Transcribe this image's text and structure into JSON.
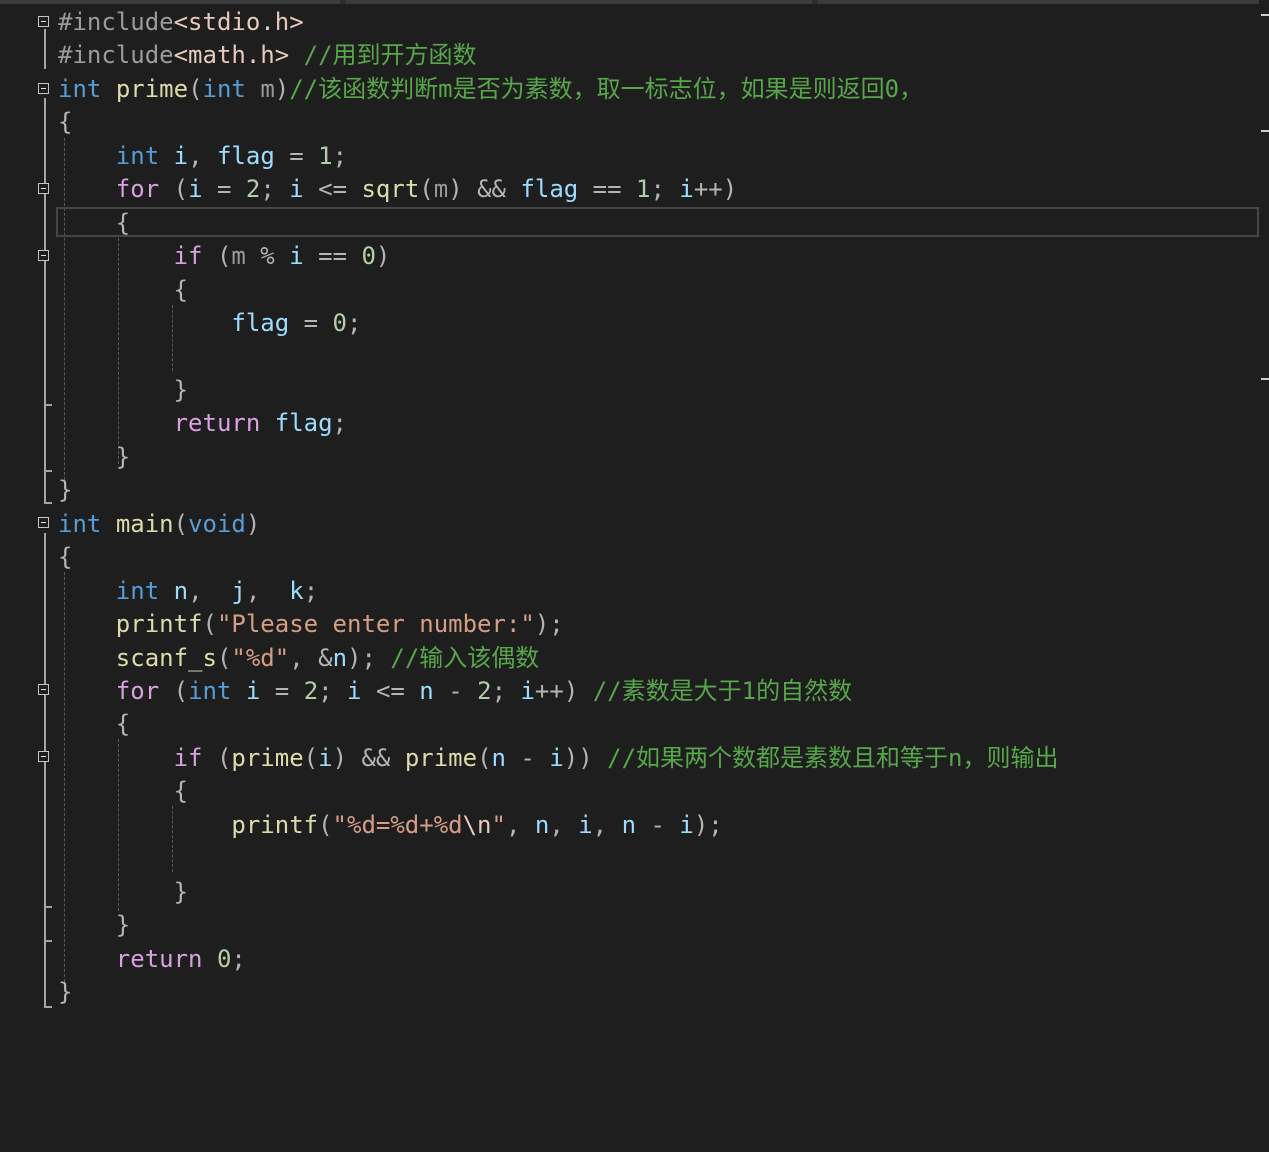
{
  "editor": {
    "colors": {
      "background": "#1e1e1e",
      "keyword": "#569cd6",
      "control": "#d8a0df",
      "function": "#dcdcaa",
      "variable": "#9cdcfe",
      "number": "#b5cea8",
      "string": "#d69d85",
      "comment": "#57a64a",
      "preprocessor": "#9b9b9b"
    },
    "lines": [
      [
        [
          "pp",
          "#include"
        ],
        [
          "inc",
          "<stdio.h>"
        ]
      ],
      [
        [
          "pp",
          "#include"
        ],
        [
          "inc",
          "<math.h>"
        ],
        [
          "pn",
          " "
        ],
        [
          "cm",
          "//用到开方函数"
        ]
      ],
      [
        [
          "kw",
          "int"
        ],
        [
          "pn",
          " "
        ],
        [
          "fn",
          "prime"
        ],
        [
          "pn",
          "("
        ],
        [
          "kw",
          "int"
        ],
        [
          "pn",
          " "
        ],
        [
          "param",
          "m"
        ],
        [
          "pn",
          ")"
        ],
        [
          "cm",
          "//该函数判断m是否为素数，取一标志位，如果是则返回0，"
        ]
      ],
      [
        [
          "pn",
          "{"
        ]
      ],
      [
        [
          "pn",
          "    "
        ],
        [
          "kw",
          "int"
        ],
        [
          "pn",
          " "
        ],
        [
          "var",
          "i"
        ],
        [
          "pn",
          ", "
        ],
        [
          "var",
          "flag"
        ],
        [
          "op",
          " = "
        ],
        [
          "num",
          "1"
        ],
        [
          "pn",
          ";"
        ]
      ],
      [
        [
          "pn",
          "    "
        ],
        [
          "ctl",
          "for"
        ],
        [
          "pn",
          " ("
        ],
        [
          "var",
          "i"
        ],
        [
          "op",
          " = "
        ],
        [
          "num",
          "2"
        ],
        [
          "pn",
          "; "
        ],
        [
          "var",
          "i"
        ],
        [
          "op",
          " <= "
        ],
        [
          "fn",
          "sqrt"
        ],
        [
          "pn",
          "("
        ],
        [
          "param",
          "m"
        ],
        [
          "pn",
          ")"
        ],
        [
          "op",
          " && "
        ],
        [
          "var",
          "flag"
        ],
        [
          "op",
          " == "
        ],
        [
          "num",
          "1"
        ],
        [
          "pn",
          "; "
        ],
        [
          "var",
          "i"
        ],
        [
          "op",
          "++"
        ],
        [
          "pn",
          ")"
        ]
      ],
      [
        [
          "pn",
          "    {"
        ]
      ],
      [
        [
          "pn",
          "        "
        ],
        [
          "ctl",
          "if"
        ],
        [
          "pn",
          " ("
        ],
        [
          "param",
          "m"
        ],
        [
          "op",
          " % "
        ],
        [
          "var",
          "i"
        ],
        [
          "op",
          " == "
        ],
        [
          "num",
          "0"
        ],
        [
          "pn",
          ")"
        ]
      ],
      [
        [
          "pn",
          "        {"
        ]
      ],
      [
        [
          "pn",
          "            "
        ],
        [
          "var",
          "flag"
        ],
        [
          "op",
          " = "
        ],
        [
          "num",
          "0"
        ],
        [
          "pn",
          ";"
        ]
      ],
      [
        [
          "pn",
          ""
        ]
      ],
      [
        [
          "pn",
          "        }"
        ]
      ],
      [
        [
          "pn",
          "        "
        ],
        [
          "ctl",
          "return"
        ],
        [
          "pn",
          " "
        ],
        [
          "var",
          "flag"
        ],
        [
          "pn",
          ";"
        ]
      ],
      [
        [
          "pn",
          "    }"
        ]
      ],
      [
        [
          "pn",
          "}"
        ]
      ],
      [
        [
          "kw",
          "int"
        ],
        [
          "pn",
          " "
        ],
        [
          "fn",
          "main"
        ],
        [
          "pn",
          "("
        ],
        [
          "kw",
          "void"
        ],
        [
          "pn",
          ")"
        ]
      ],
      [
        [
          "pn",
          "{"
        ]
      ],
      [
        [
          "pn",
          "    "
        ],
        [
          "kw",
          "int"
        ],
        [
          "pn",
          " "
        ],
        [
          "var",
          "n"
        ],
        [
          "pn",
          ",  "
        ],
        [
          "var",
          "j"
        ],
        [
          "pn",
          ",  "
        ],
        [
          "var",
          "k"
        ],
        [
          "pn",
          ";"
        ]
      ],
      [
        [
          "pn",
          "    "
        ],
        [
          "fn",
          "printf"
        ],
        [
          "pn",
          "("
        ],
        [
          "str",
          "\"Please enter number:\""
        ],
        [
          "pn",
          ");"
        ]
      ],
      [
        [
          "pn",
          "    "
        ],
        [
          "fn",
          "scanf_s"
        ],
        [
          "pn",
          "("
        ],
        [
          "str",
          "\"%d\""
        ],
        [
          "pn",
          ", "
        ],
        [
          "op",
          "&"
        ],
        [
          "var",
          "n"
        ],
        [
          "pn",
          "); "
        ],
        [
          "cm",
          "//输入该偶数"
        ]
      ],
      [
        [
          "pn",
          "    "
        ],
        [
          "ctl",
          "for"
        ],
        [
          "pn",
          " ("
        ],
        [
          "kw",
          "int"
        ],
        [
          "pn",
          " "
        ],
        [
          "var",
          "i"
        ],
        [
          "op",
          " = "
        ],
        [
          "num",
          "2"
        ],
        [
          "pn",
          "; "
        ],
        [
          "var",
          "i"
        ],
        [
          "op",
          " <= "
        ],
        [
          "var",
          "n"
        ],
        [
          "op",
          " - "
        ],
        [
          "num",
          "2"
        ],
        [
          "pn",
          "; "
        ],
        [
          "var",
          "i"
        ],
        [
          "op",
          "++"
        ],
        [
          "pn",
          ") "
        ],
        [
          "cm",
          "//素数是大于1的自然数"
        ]
      ],
      [
        [
          "pn",
          "    {"
        ]
      ],
      [
        [
          "pn",
          "        "
        ],
        [
          "ctl",
          "if"
        ],
        [
          "pn",
          " ("
        ],
        [
          "fn",
          "prime"
        ],
        [
          "pn",
          "("
        ],
        [
          "var",
          "i"
        ],
        [
          "pn",
          ")"
        ],
        [
          "op",
          " && "
        ],
        [
          "fn",
          "prime"
        ],
        [
          "pn",
          "("
        ],
        [
          "var",
          "n"
        ],
        [
          "op",
          " - "
        ],
        [
          "var",
          "i"
        ],
        [
          "pn",
          "))"
        ],
        [
          "pn",
          " "
        ],
        [
          "cm",
          "//如果两个数都是素数且和等于n，则输出"
        ]
      ],
      [
        [
          "pn",
          "        {"
        ]
      ],
      [
        [
          "pn",
          "            "
        ],
        [
          "fn",
          "printf"
        ],
        [
          "pn",
          "("
        ],
        [
          "str",
          "\"%d=%d+%d"
        ],
        [
          "esc",
          "\\n"
        ],
        [
          "str",
          "\""
        ],
        [
          "pn",
          ", "
        ],
        [
          "var",
          "n"
        ],
        [
          "pn",
          ", "
        ],
        [
          "var",
          "i"
        ],
        [
          "pn",
          ", "
        ],
        [
          "var",
          "n"
        ],
        [
          "op",
          " - "
        ],
        [
          "var",
          "i"
        ],
        [
          "pn",
          ");"
        ]
      ],
      [
        [
          "pn",
          ""
        ]
      ],
      [
        [
          "pn",
          "        }"
        ]
      ],
      [
        [
          "pn",
          "    }"
        ]
      ],
      [
        [
          "pn",
          "    "
        ],
        [
          "ctl",
          "return"
        ],
        [
          "pn",
          " "
        ],
        [
          "num",
          "0"
        ],
        [
          "pn",
          ";"
        ]
      ],
      [
        [
          "pn",
          "}"
        ]
      ]
    ]
  }
}
